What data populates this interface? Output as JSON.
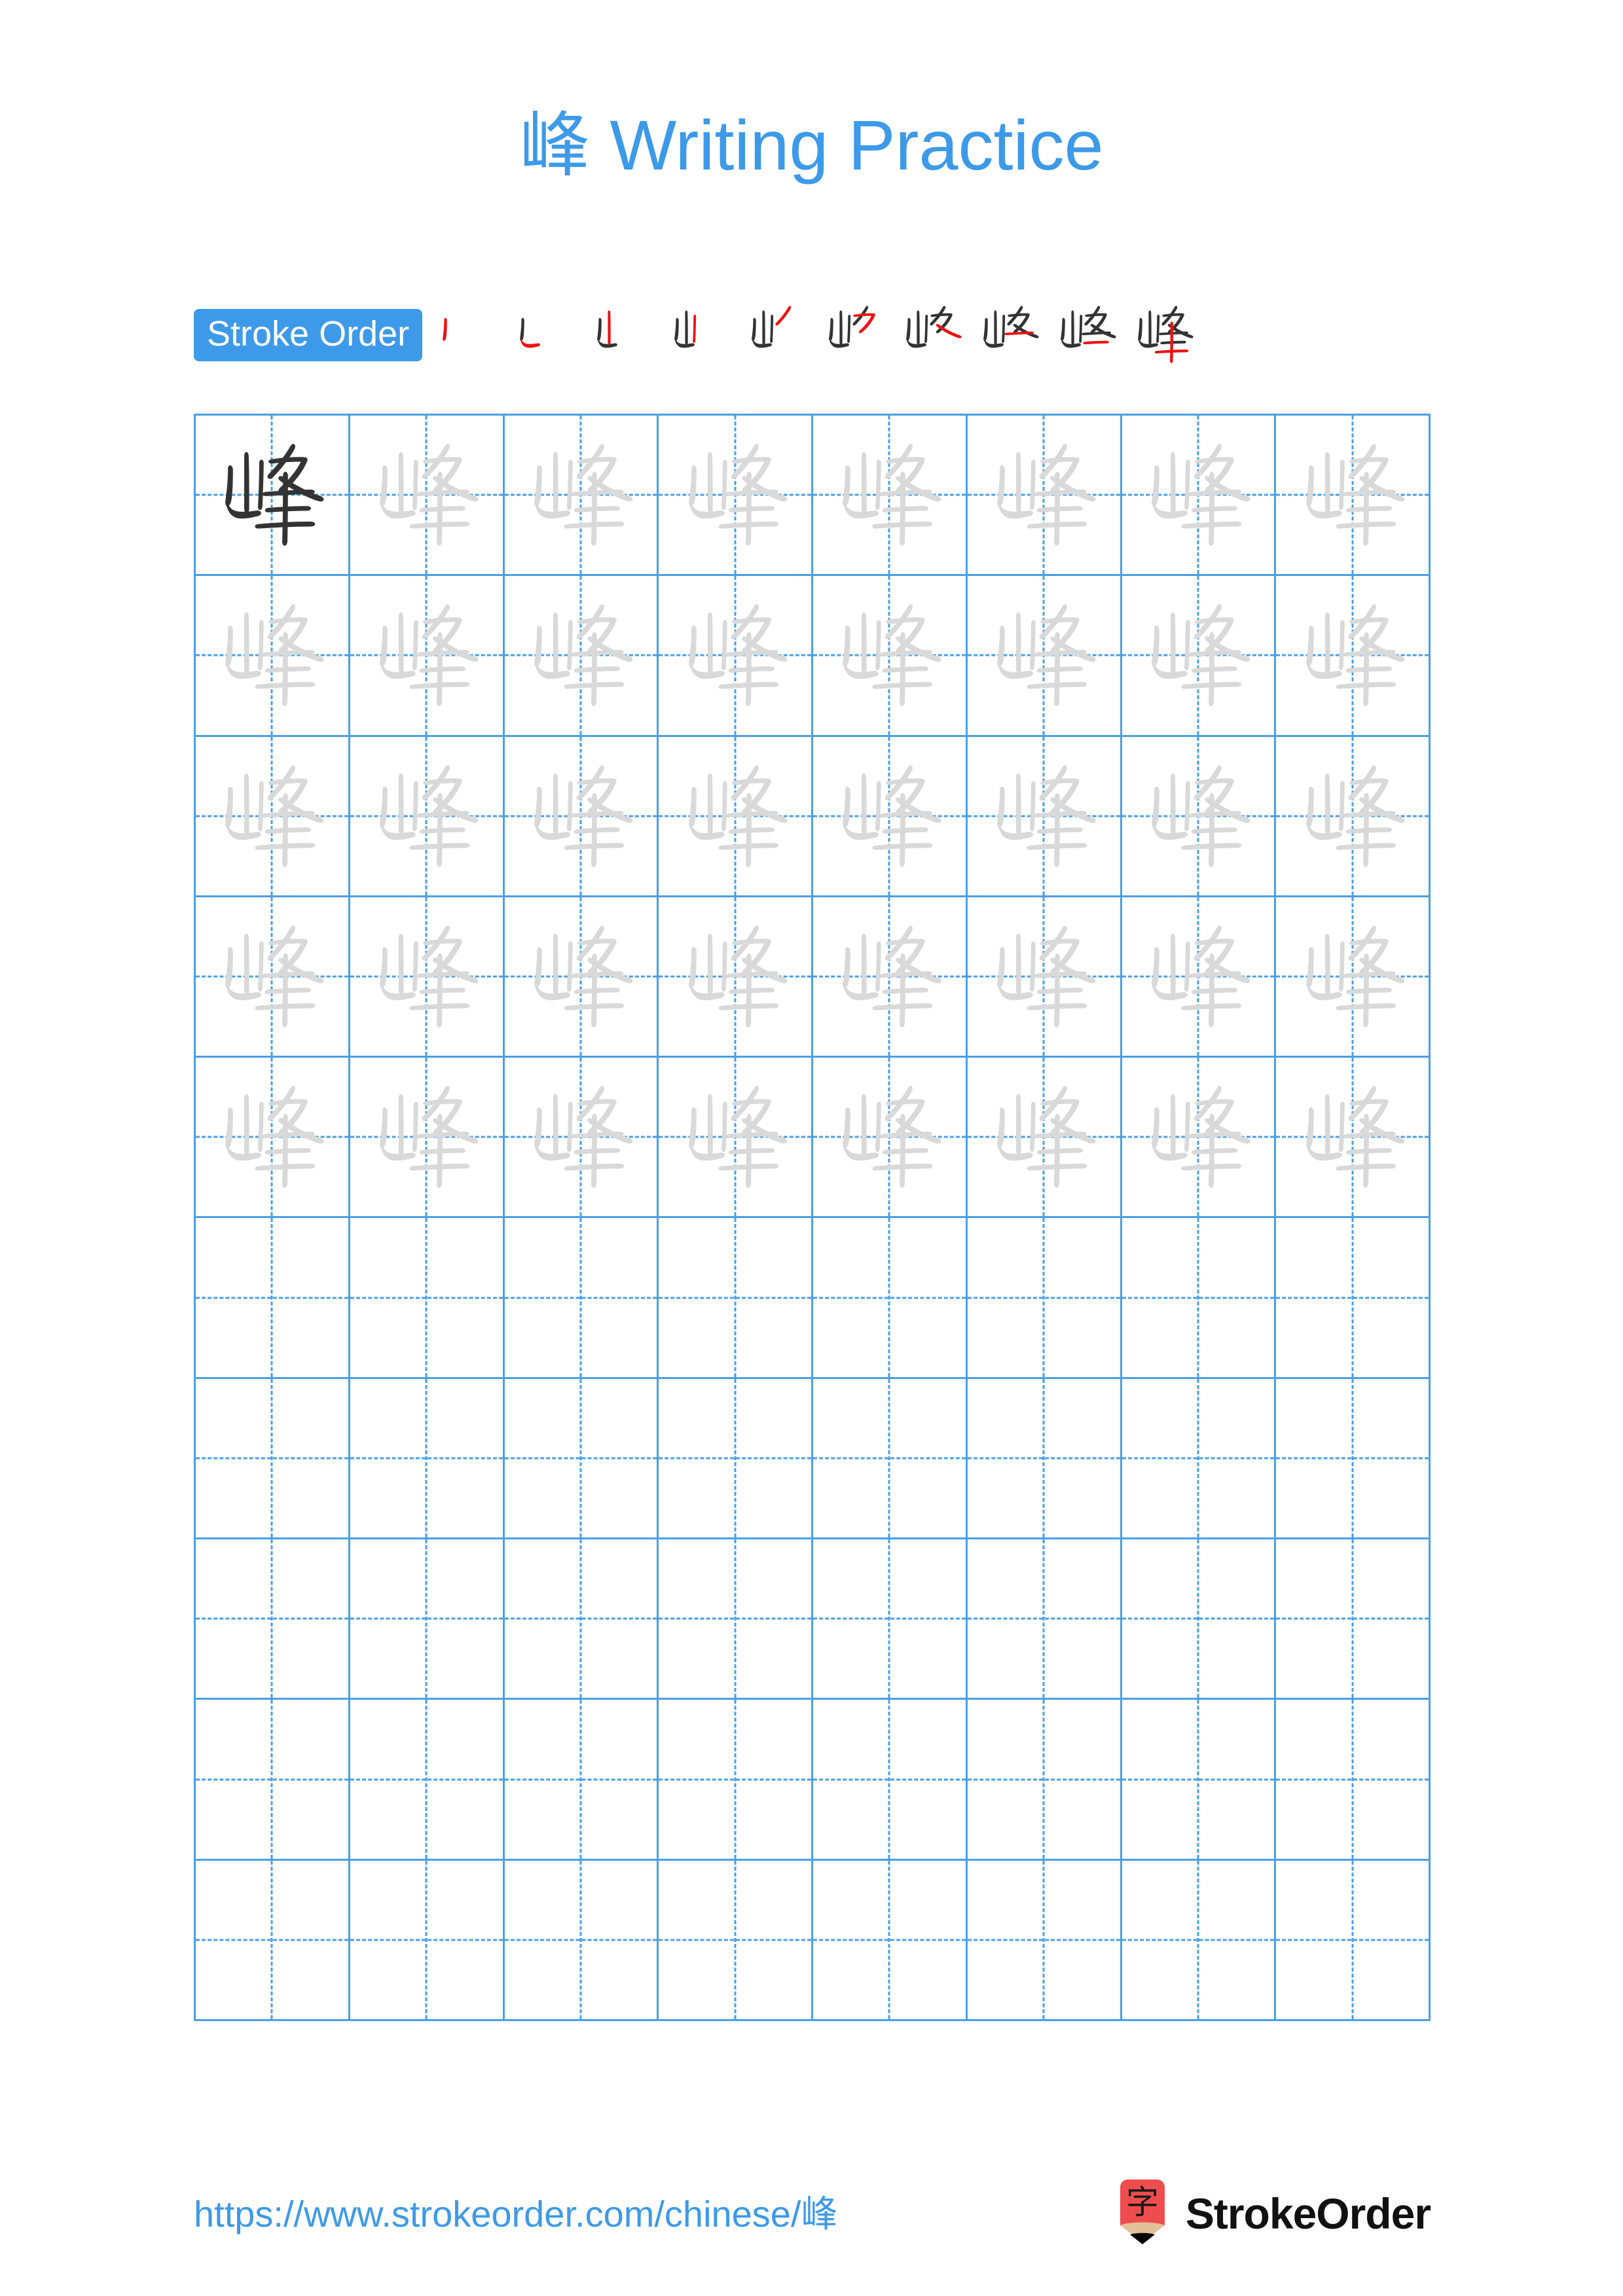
{
  "page": {
    "character": "峰",
    "title": "峰 Writing Practice",
    "title_character": "峰",
    "title_text": " Writing Practice",
    "background_color": "#ffffff"
  },
  "stroke_order": {
    "label": "Stroke Order",
    "badge_background": "#3d9ae8",
    "badge_text_color": "#ffffff",
    "new_stroke_color": "#ee1111",
    "prior_stroke_color": "#333333",
    "total_strokes": 10,
    "steps": [
      {
        "index": 1,
        "strokes_shown": 1,
        "new_stroke": "丨"
      },
      {
        "index": 2,
        "strokes_shown": 2,
        "new_stroke": "㇗"
      },
      {
        "index": 3,
        "strokes_shown": 3,
        "new_stroke": "丨"
      },
      {
        "index": 4,
        "strokes_shown": 4,
        "new_stroke": "丿"
      },
      {
        "index": 5,
        "strokes_shown": 5,
        "new_stroke": "㇇"
      },
      {
        "index": 6,
        "strokes_shown": 6,
        "new_stroke": "㇏"
      },
      {
        "index": 7,
        "strokes_shown": 7,
        "new_stroke": "一"
      },
      {
        "index": 8,
        "strokes_shown": 8,
        "new_stroke": "一"
      },
      {
        "index": 9,
        "strokes_shown": 9,
        "new_stroke": "一"
      },
      {
        "index": 10,
        "strokes_shown": 10,
        "new_stroke": "丨"
      }
    ]
  },
  "practice_grid": {
    "columns": 8,
    "rows": 10,
    "grid_line_color": "#4a9fe8",
    "guide_line_color": "#4a9fe8",
    "model_char_color": "#333333",
    "trace_char_color": "#d9d9d9",
    "filled_rows": 5,
    "empty_rows": 5,
    "rows_data": [
      {
        "row": 1,
        "cells": [
          "峰",
          "峰",
          "峰",
          "峰",
          "峰",
          "峰",
          "峰",
          "峰"
        ],
        "styles": [
          "dark",
          "trace",
          "trace",
          "trace",
          "trace",
          "trace",
          "trace",
          "trace"
        ]
      },
      {
        "row": 2,
        "cells": [
          "峰",
          "峰",
          "峰",
          "峰",
          "峰",
          "峰",
          "峰",
          "峰"
        ],
        "styles": [
          "trace",
          "trace",
          "trace",
          "trace",
          "trace",
          "trace",
          "trace",
          "trace"
        ]
      },
      {
        "row": 3,
        "cells": [
          "峰",
          "峰",
          "峰",
          "峰",
          "峰",
          "峰",
          "峰",
          "峰"
        ],
        "styles": [
          "trace",
          "trace",
          "trace",
          "trace",
          "trace",
          "trace",
          "trace",
          "trace"
        ]
      },
      {
        "row": 4,
        "cells": [
          "峰",
          "峰",
          "峰",
          "峰",
          "峰",
          "峰",
          "峰",
          "峰"
        ],
        "styles": [
          "trace",
          "trace",
          "trace",
          "trace",
          "trace",
          "trace",
          "trace",
          "trace"
        ]
      },
      {
        "row": 5,
        "cells": [
          "峰",
          "峰",
          "峰",
          "峰",
          "峰",
          "峰",
          "峰",
          "峰"
        ],
        "styles": [
          "trace",
          "trace",
          "trace",
          "trace",
          "trace",
          "trace",
          "trace",
          "trace"
        ]
      },
      {
        "row": 6,
        "cells": [
          "",
          "",
          "",
          "",
          "",
          "",
          "",
          ""
        ],
        "styles": [
          "empty",
          "empty",
          "empty",
          "empty",
          "empty",
          "empty",
          "empty",
          "empty"
        ]
      },
      {
        "row": 7,
        "cells": [
          "",
          "",
          "",
          "",
          "",
          "",
          "",
          ""
        ],
        "styles": [
          "empty",
          "empty",
          "empty",
          "empty",
          "empty",
          "empty",
          "empty",
          "empty"
        ]
      },
      {
        "row": 8,
        "cells": [
          "",
          "",
          "",
          "",
          "",
          "",
          "",
          ""
        ],
        "styles": [
          "empty",
          "empty",
          "empty",
          "empty",
          "empty",
          "empty",
          "empty",
          "empty"
        ]
      },
      {
        "row": 9,
        "cells": [
          "",
          "",
          "",
          "",
          "",
          "",
          "",
          ""
        ],
        "styles": [
          "empty",
          "empty",
          "empty",
          "empty",
          "empty",
          "empty",
          "empty",
          "empty"
        ]
      },
      {
        "row": 10,
        "cells": [
          "",
          "",
          "",
          "",
          "",
          "",
          "",
          ""
        ],
        "styles": [
          "empty",
          "empty",
          "empty",
          "empty",
          "empty",
          "empty",
          "empty",
          "empty"
        ]
      }
    ]
  },
  "footer": {
    "url": "https://www.strokeorder.com/chinese/峰",
    "url_color": "#3d9ae8",
    "brand_name": "StrokeOrder",
    "logo": {
      "icon_name": "pencil-logo",
      "character": "字",
      "body_color": "#ef4d4d",
      "wood_color": "#e3c197",
      "tip_color": "#000000"
    }
  }
}
